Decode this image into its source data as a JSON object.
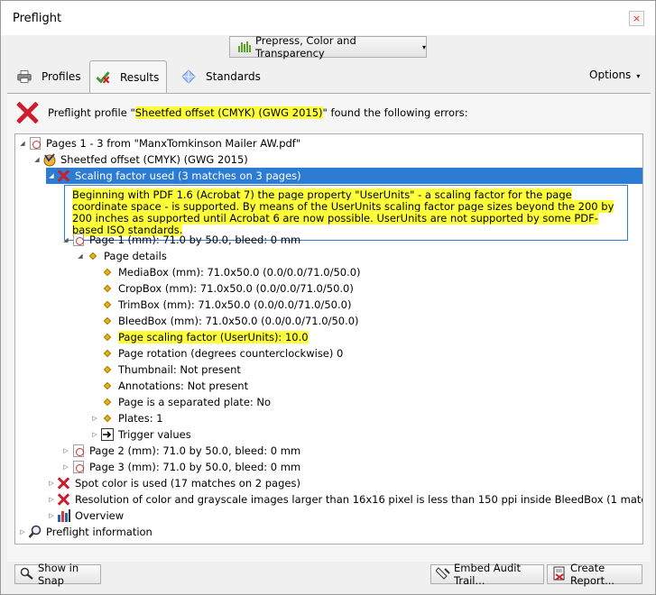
{
  "window": {
    "title": "Preflight",
    "close_glyph": "×"
  },
  "profile_dropdown": {
    "label": "Prepress, Color and Transparency",
    "caret": "▾"
  },
  "tabs": [
    {
      "label": "Profiles",
      "icon": "printer-icon"
    },
    {
      "label": "Results",
      "icon": "checkmark-icon",
      "active": true
    },
    {
      "label": "Standards",
      "icon": "diamond-icon"
    }
  ],
  "options": {
    "label": "Options",
    "caret": "▾"
  },
  "result_header": {
    "prefix": "Preflight profile \"",
    "profile_name": "Sheetfed offset (CMYK) (GWG 2015)",
    "suffix": "\" found the following errors:"
  },
  "tree": {
    "root": "Pages 1 - 3 from \"ManxTomkinson Mailer AW.pdf\"",
    "profile": "Sheetfed offset (CMYK) (GWG 2015)",
    "scaling_error": "Scaling factor used (3 matches on 3 pages)",
    "description": "Beginning with PDF 1.6 (Acrobat 7) the page property \"UserUnits\" - a scaling factor for the page coordinate space - is supported. By means of the UserUnits scaling factor page sizes beyond the 200 by 200 inches as supported until Acrobat 6 are now possible. UserUnits are not supported by some PDF-based ISO standards.",
    "page1": "Page 1 (mm): 71.0 by 50.0, bleed: 0 mm",
    "page_details": "Page details",
    "details": [
      "MediaBox (mm): 71.0x50.0 (0.0/0.0/71.0/50.0)",
      "CropBox (mm): 71.0x50.0 (0.0/0.0/71.0/50.0)",
      "TrimBox (mm): 71.0x50.0 (0.0/0.0/71.0/50.0)",
      "BleedBox (mm): 71.0x50.0 (0.0/0.0/71.0/50.0)",
      "Page scaling factor (UserUnits): 10.0",
      "Page rotation (degrees counterclockwise) 0",
      "Thumbnail: Not present",
      "Annotations: Not present",
      "Page is a separated plate: No"
    ],
    "plates": "Plates: 1",
    "trigger": "Trigger values",
    "page2": "Page 2 (mm): 71.0 by 50.0, bleed: 0 mm",
    "page3": "Page 3 (mm): 71.0 by 50.0, bleed: 0 mm",
    "spot_error": "Spot color is used (17 matches on 2 pages)",
    "resolution_error": "Resolution of color and grayscale images larger than 16x16 pixel is less than 150 ppi inside BleedBox  (1 match on 1 page)",
    "overview": "Overview",
    "info": "Preflight information"
  },
  "buttons": {
    "show_in_snap": "Show in Snap",
    "embed_audit": "Embed Audit Trail...",
    "create_report": "Create Report..."
  },
  "colors": {
    "selection": "#2d7cd3",
    "highlight": "#ffff3a",
    "error": "#cc1e2e"
  }
}
